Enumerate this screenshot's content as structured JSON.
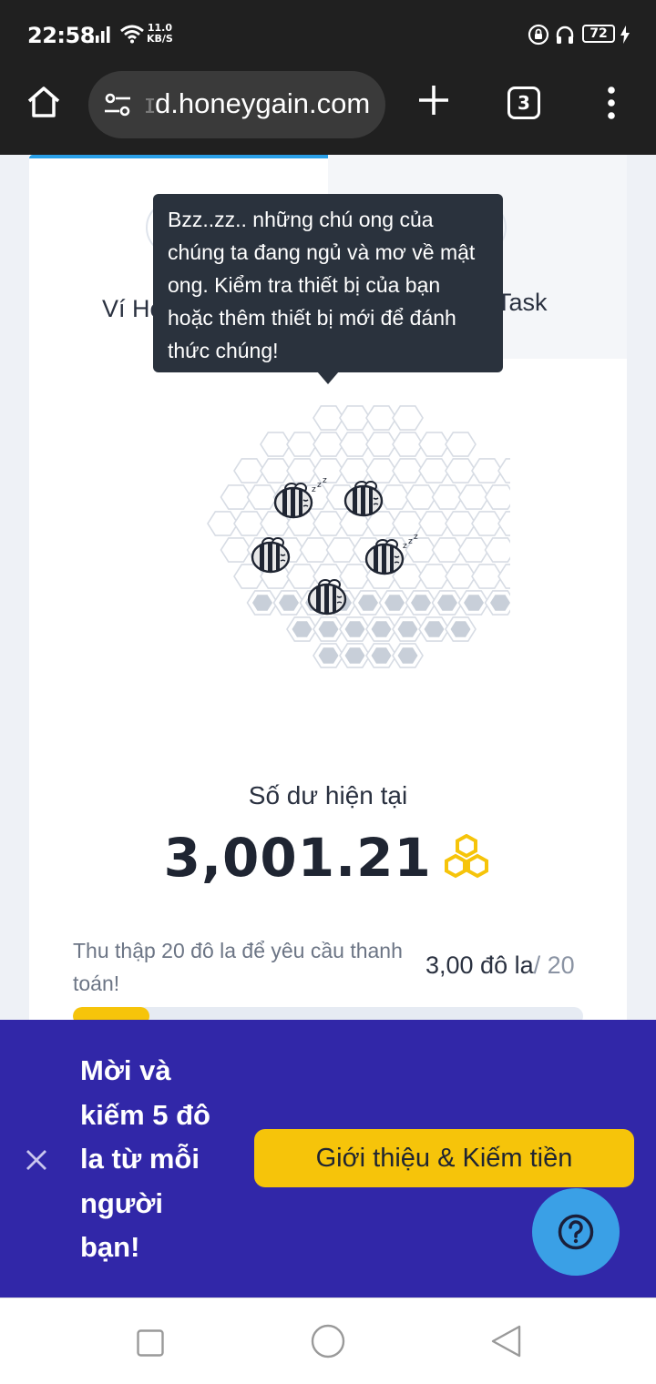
{
  "status_bar": {
    "time": "22:58",
    "net_speed_value": "11.0",
    "net_speed_unit": "KB/S",
    "battery": "72"
  },
  "browser": {
    "url_faded": "ɪ",
    "url": "d.honeygain.com",
    "tab_count": "3"
  },
  "tabs": {
    "left_label": "Ví Ho",
    "right_label": "Task"
  },
  "tooltip": {
    "text": "Bzz..zz.. những chú ong của chúng ta đang ngủ và mơ về mật ong. Kiểm tra thiết bị của bạn hoặc thêm thiết bị mới để đánh thức chúng!"
  },
  "balance": {
    "label": "Số dư hiện tại",
    "value": "3,001.21"
  },
  "payout": {
    "collect_text": "Thu thập 20 đô la để yêu cầu thanh toán!",
    "current": "3,00 đô la",
    "target": "/ 20",
    "progress_fraction": 0.15
  },
  "banner": {
    "text": "Mời và kiếm 5 đô la từ mỗi người bạn!",
    "button_label": "Giới thiệu & Kiếm tiền"
  },
  "colors": {
    "accent_yellow": "#f6c40a",
    "banner_bg": "#3127a8",
    "help_blue": "#3aa0e6",
    "tab_accent": "#2aa0e8",
    "tooltip_bg": "#2a323d"
  }
}
